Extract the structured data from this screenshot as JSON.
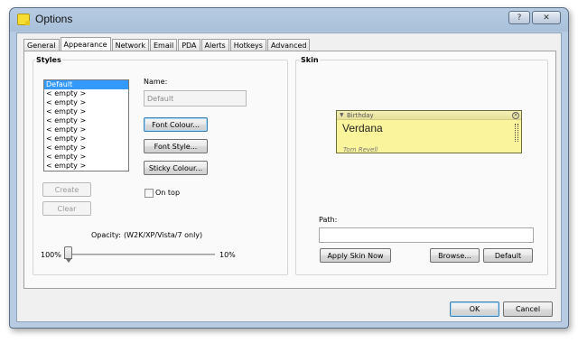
{
  "window": {
    "title": "Options",
    "help_glyph": "?",
    "close_glyph": "✕"
  },
  "tabs": [
    {
      "label": "General",
      "active": false
    },
    {
      "label": "Appearance",
      "active": true
    },
    {
      "label": "Network",
      "active": false
    },
    {
      "label": "Email",
      "active": false
    },
    {
      "label": "PDA",
      "active": false
    },
    {
      "label": "Alerts",
      "active": false
    },
    {
      "label": "Hotkeys",
      "active": false
    },
    {
      "label": "Advanced",
      "active": false
    }
  ],
  "styles": {
    "group_label": "Styles",
    "list": [
      "Default",
      "< empty >",
      "< empty >",
      "< empty >",
      "< empty >",
      "< empty >",
      "< empty >",
      "< empty >",
      "< empty >",
      "< empty >"
    ],
    "selected_index": 0,
    "name_label": "Name:",
    "name_value": "Default",
    "font_colour_button": "Font Colour...",
    "font_style_button": "Font Style...",
    "sticky_colour_button": "Sticky Colour...",
    "on_top_label": "On top",
    "on_top_checked": false,
    "create_button": "Create",
    "clear_button": "Clear",
    "opacity_label": "Opacity:",
    "opacity_note": "(W2K/XP/Vista/7 only)",
    "opacity_max_label": "100%",
    "opacity_min_label": "10%",
    "opacity_value_percent": 100
  },
  "skin": {
    "group_label": "Skin",
    "preview": {
      "title": "Birthday",
      "body": "Verdana",
      "author": "Tom Revell",
      "background_color": "#faf59c"
    },
    "path_label": "Path:",
    "path_value": "",
    "apply_button": "Apply Skin Now",
    "browse_button": "Browse...",
    "default_button": "Default"
  },
  "dialog": {
    "ok_button": "OK",
    "cancel_button": "Cancel"
  },
  "colors": {
    "titlebar": "#a9c0da",
    "selection": "#3399ff",
    "note_yellow": "#faf59c"
  }
}
